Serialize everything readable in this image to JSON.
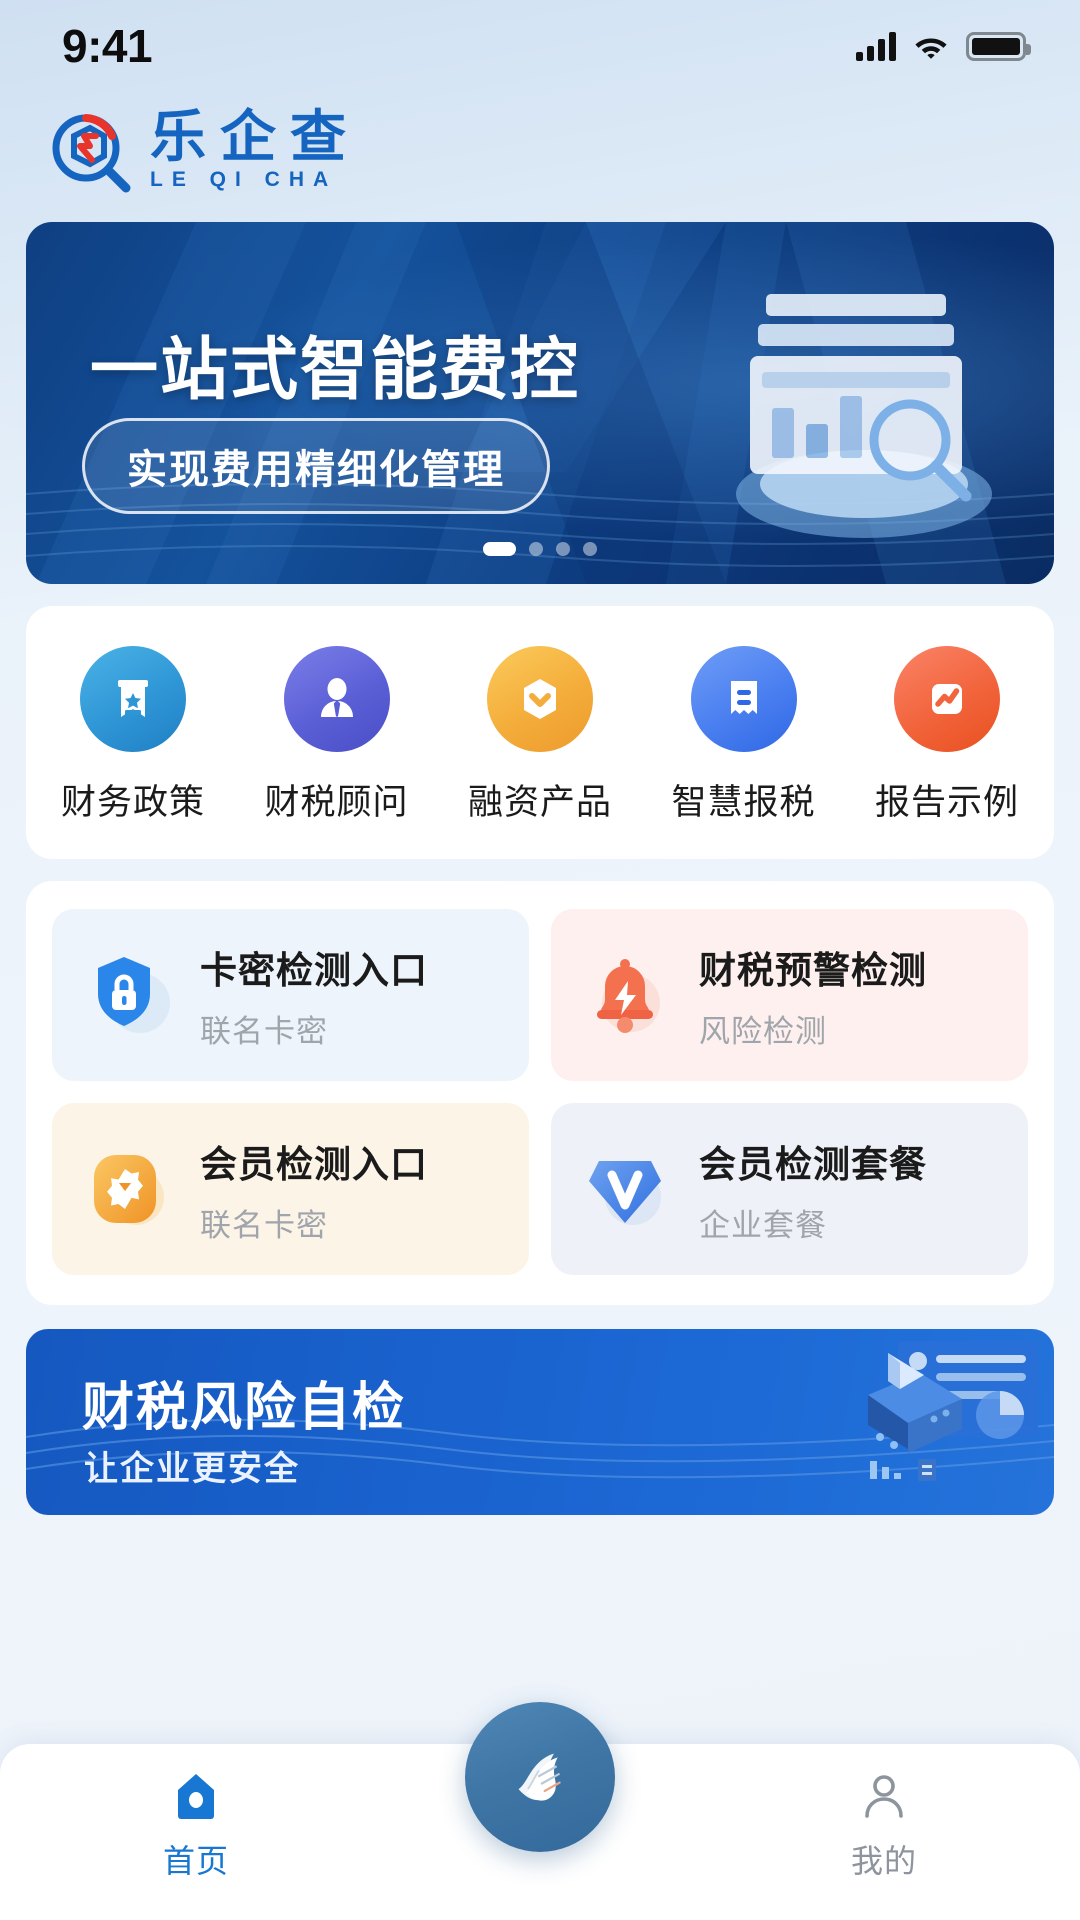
{
  "status_bar": {
    "time": "9:41",
    "signal_icon": "cellular-signal-icon",
    "wifi_icon": "wifi-icon",
    "battery_icon": "battery-icon"
  },
  "brand": {
    "logo_icon": "leqicha-logo-icon",
    "name_cn": "乐企查",
    "name_en": "LE QI CHA",
    "color": "#1565c0"
  },
  "hero": {
    "title": "一站式智能费控",
    "pill": "实现费用精细化管理",
    "art_icon": "dashboard-illustration-icon",
    "dots": [
      "active",
      "",
      "",
      ""
    ],
    "bg_color": "#0f3f82"
  },
  "quick_actions": [
    {
      "label": "财务政策",
      "icon": "certificate-badge-icon",
      "color": "#2d9cdb"
    },
    {
      "label": "财税顾问",
      "icon": "advisor-person-icon",
      "color": "#5b5fd6"
    },
    {
      "label": "融资产品",
      "icon": "hexagon-chevron-icon",
      "color": "#f5b542"
    },
    {
      "label": "智慧报税",
      "icon": "receipt-icon",
      "color": "#4a7ff0"
    },
    {
      "label": "报告示例",
      "icon": "chart-line-icon",
      "color": "#f2643c"
    }
  ],
  "feature_cards": [
    {
      "title": "卡密检测入口",
      "subtitle": "联名卡密",
      "icon": "shield-lock-icon",
      "icon_color": "#2a86e8",
      "bg_color": "#eef4fb"
    },
    {
      "title": "财税预警检测",
      "subtitle": "风险检测",
      "icon": "bell-alert-icon",
      "icon_color": "#f4714f",
      "bg_color": "#fdf0ee"
    },
    {
      "title": "会员检测入口",
      "subtitle": "联名卡密",
      "icon": "flower-badge-icon",
      "icon_color": "#f5a93c",
      "bg_color": "#fdf4e8"
    },
    {
      "title": "会员检测套餐",
      "subtitle": "企业套餐",
      "icon": "vip-diamond-icon",
      "icon_color": "#4a85e8",
      "bg_color": "#eef2f8"
    }
  ],
  "promo": {
    "title": "财税风险自检",
    "subtitle": "让企业更安全",
    "art_icon": "data-analysis-illustration-icon",
    "bg_color": "#1558c0"
  },
  "tab_bar": {
    "items": [
      {
        "label": "首页",
        "icon": "home-icon",
        "active": true
      },
      {
        "label": "",
        "icon": "documents-fab-icon",
        "active": false
      },
      {
        "label": "我的",
        "icon": "user-profile-icon",
        "active": false
      }
    ],
    "active_color": "#1877d2",
    "inactive_color": "#8d949e"
  }
}
